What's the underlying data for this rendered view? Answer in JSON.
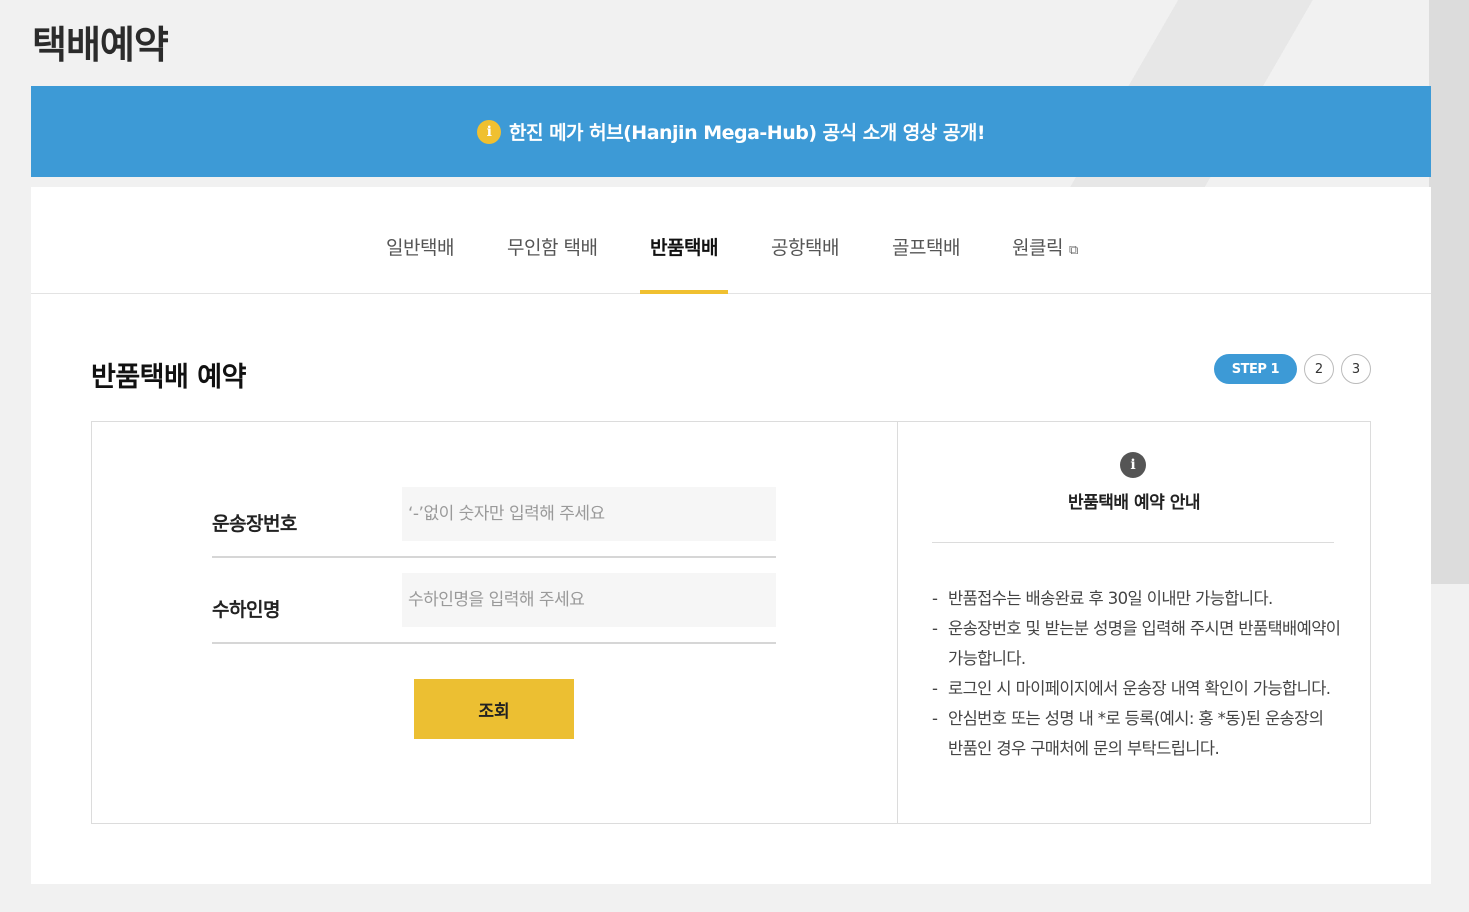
{
  "page": {
    "title": "택배예약"
  },
  "notice": {
    "icon": "i",
    "text": "한진 메가 허브(Hanjin Mega-Hub) 공식 소개 영상 공개!"
  },
  "tabs": [
    {
      "label": "일반택배"
    },
    {
      "label": "무인함 택배"
    },
    {
      "label": "반품택배",
      "active": true
    },
    {
      "label": "공항택배"
    },
    {
      "label": "골프택배"
    },
    {
      "label": "원클릭",
      "external": true
    }
  ],
  "section": {
    "title": "반품택배 예약"
  },
  "steps": {
    "active": "STEP 1",
    "step2": "2",
    "step3": "3"
  },
  "form": {
    "waybill": {
      "label": "운송장번호",
      "placeholder": "‘-’없이 숫자만 입력해 주세요"
    },
    "receiver": {
      "label": "수하인명",
      "placeholder": "수하인명을 입력해 주세요"
    },
    "search_label": "조회"
  },
  "info": {
    "icon": "i",
    "title": "반품택배 예약 안내",
    "items": [
      "반품접수는 배송완료 후 30일 이내만 가능합니다.",
      "운송장번호 및 받는분 성명을 입력해 주시면 반품택배예약이 가능합니다.",
      "로그인 시 마이페이지에서 운송장 내역 확인이 가능합니다.",
      "안심번호 또는 성명 내 *로 등록(예시: 홍 *동)된 운송장의 반품인 경우 구매처에 문의 부탁드립니다."
    ]
  },
  "colors": {
    "accent_blue": "#3d9ad6",
    "accent_yellow": "#ecbf32"
  }
}
